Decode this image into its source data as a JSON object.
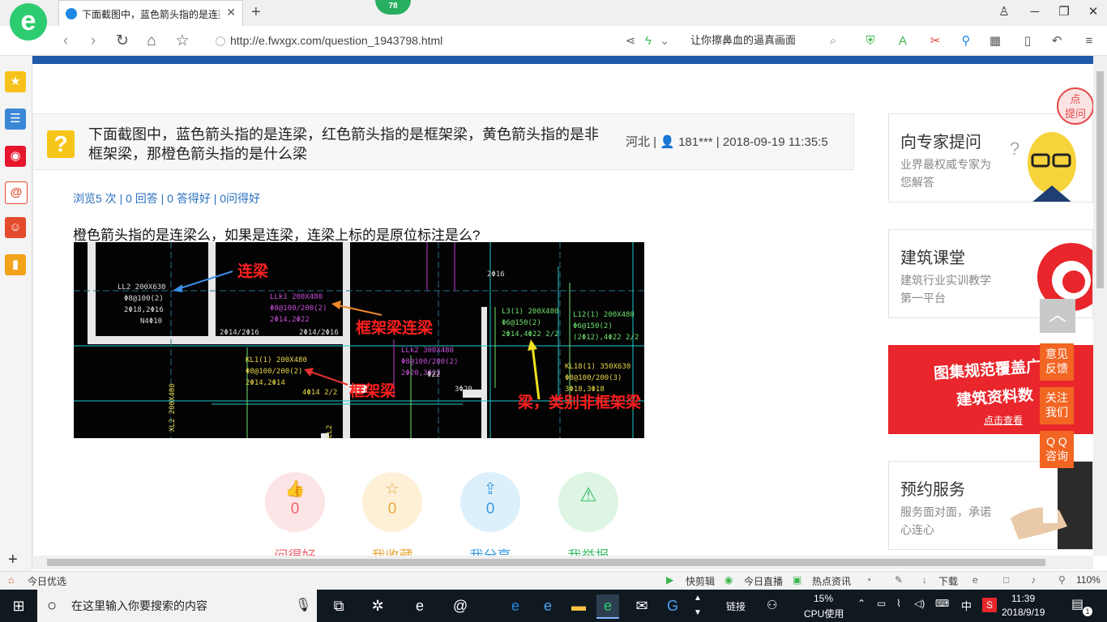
{
  "browser": {
    "tab_title": "下面截图中，蓝色箭头指的是连梁…",
    "tab_badge": "78",
    "url": "http://e.fwxgx.com/question_1943798.html",
    "omnibox_text": "让你擦鼻血的逼真画面",
    "logo_letter": "e"
  },
  "question": {
    "title": "下面截图中，蓝色箭头指的是连梁，红色箭头指的是框架梁，黄色箭头指的是非框架梁，那橙色箭头指的是什么梁",
    "meta": "河北 | 👤 181*** | 2018-09-19 11:35:5",
    "stats": "浏览5 次 | 0 回答 | 0 答得好 | 0问得好",
    "body": "橙色箭头指的是连梁么，如果是连梁，连梁上标的是原位标注是么?"
  },
  "cad": {
    "labels": {
      "ll2": "LL2 200X630",
      "ll2_a": "Φ8@100(2)",
      "ll2_b": "2Φ18,2Φ16",
      "ll2_c": "N4Φ10",
      "llk1": "LLk1 200X480",
      "llk1_a": "Φ8@100/200(2)",
      "llk1_b": "2Φ14,2Φ22",
      "llk2": "LLk2 300X480",
      "llk2_a": "Φ8@100/200(2)",
      "llk2_b": "2Φ20,3Φ22",
      "kl1": "KL1(1) 200X480",
      "kl1_a": "Φ8@100/200(2)",
      "kl1_b": "2Φ14,2Φ14",
      "l3": "L3(1) 200X480",
      "l3_a": "Φ6@150(2)",
      "l3_b": "2Φ14,4Φ22 2/2",
      "l12": "L12(1) 200X480",
      "l12_a": "Φ6@150(2)",
      "l12_b": "(2Φ12),4Φ22 2/2",
      "kl18": "KL18(1) 350X630",
      "kl18_a": "Φ8@100/200(3)",
      "kl18_b": "3Φ18,3Φ18",
      "t1": "2Φ14/2Φ16",
      "t2": "2Φ14/2Φ16",
      "t3": "4Φ14 2/2",
      "t4": "2Φ16",
      "t5": "3Φ20",
      "t6": "Φ22",
      "t7": "XL2 200X480",
      "t8": "LL2"
    },
    "annotations": {
      "lianliang": "连梁",
      "kuangjia_lianliang": "框架梁连梁",
      "kuangjia": "框架梁",
      "feikuangjia": "梁，类别非框架梁"
    }
  },
  "actions": [
    {
      "label": "问得好",
      "count": "0",
      "icon": "thumbs-up-icon",
      "bg": "#fde4e6",
      "color": "#f0656f"
    },
    {
      "label": "我收藏",
      "count": "0",
      "icon": "star-icon",
      "bg": "#fdf0d7",
      "color": "#e8a83a"
    },
    {
      "label": "我分享",
      "count": "0",
      "icon": "share-icon",
      "bg": "#dcf0fb",
      "color": "#3a9be0"
    },
    {
      "label": "我举报",
      "count": "",
      "icon": "warning-icon",
      "bg": "#def5e3",
      "color": "#3dbf6a"
    }
  ],
  "sidebar_cards": [
    {
      "title": "向专家提问",
      "subtitle": "业界最权威专家为您解答"
    },
    {
      "title": "建筑课堂",
      "subtitle": "建筑行业实训教学第一平台"
    },
    {
      "title": "",
      "subtitle": "",
      "banner_line1": "图集规范覆盖广",
      "banner_line2": "建筑资料数",
      "banner_cta": "点击查看"
    },
    {
      "title": "预约服务",
      "subtitle": "服务面对面，承诺心连心"
    }
  ],
  "float_buttons": {
    "feedback": "意见\n反馈",
    "follow": "关注\n我们",
    "qq": "Q Q\n咨询",
    "ask_bubble": "点\n提问"
  },
  "statusbar": {
    "left": "今日优选",
    "kuaijianji": "快剪辑",
    "live": "今日直播",
    "news": "热点资讯",
    "download": "下载",
    "zoom": "110%"
  },
  "taskbar": {
    "search_placeholder": "在这里输入你要搜索的内容",
    "link": "链接",
    "cpu_percent": "15%",
    "cpu_label": "CPU使用",
    "ime": "中",
    "time": "11:39",
    "date": "2018/9/19",
    "notif_count": "1"
  },
  "colors": {
    "accent_blue": "#1e5aa8",
    "float_orange": "#f26522",
    "link_blue": "#2a6fbf"
  }
}
